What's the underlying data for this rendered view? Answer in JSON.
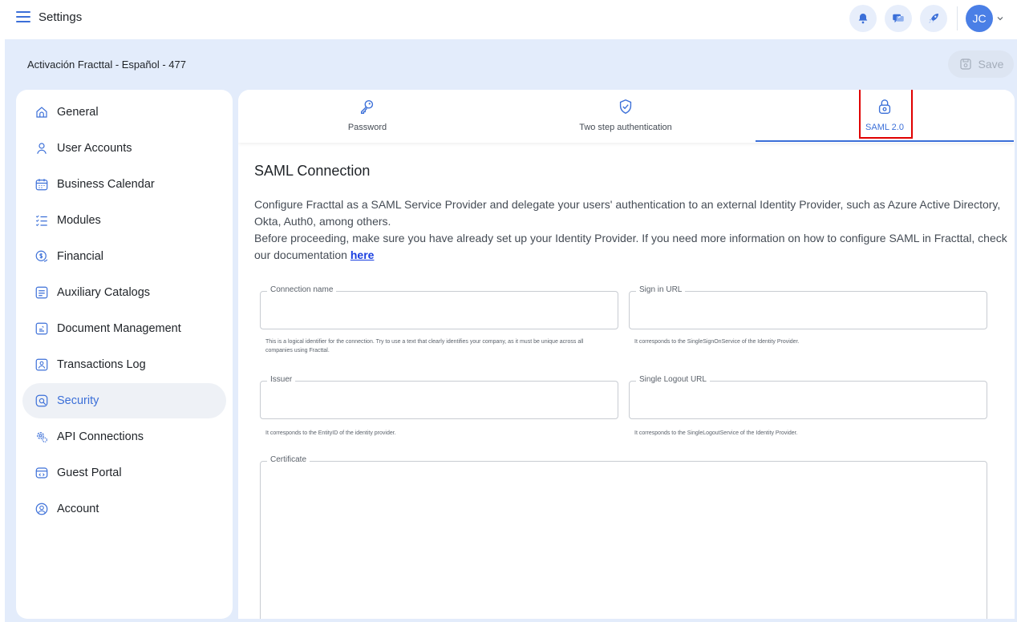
{
  "app": {
    "title": "Settings"
  },
  "header": {
    "breadcrumb": "Activación Fracttal - Español - 477",
    "save_label": "Save",
    "avatar_initials": "JC"
  },
  "sidebar": {
    "items": [
      {
        "label": "General",
        "icon": "home-icon"
      },
      {
        "label": "User Accounts",
        "icon": "user-icon"
      },
      {
        "label": "Business Calendar",
        "icon": "calendar-icon"
      },
      {
        "label": "Modules",
        "icon": "list-icon"
      },
      {
        "label": "Financial",
        "icon": "money-icon"
      },
      {
        "label": "Auxiliary Catalogs",
        "icon": "catalog-icon"
      },
      {
        "label": "Document Management",
        "icon": "document-icon"
      },
      {
        "label": "Transactions Log",
        "icon": "log-icon"
      },
      {
        "label": "Security",
        "icon": "security-icon",
        "active": true
      },
      {
        "label": "API Connections",
        "icon": "api-gear-icon"
      },
      {
        "label": "Guest Portal",
        "icon": "portal-icon"
      },
      {
        "label": "Account",
        "icon": "account-icon"
      }
    ]
  },
  "tabs": [
    {
      "label": "Password",
      "icon": "key-icon"
    },
    {
      "label": "Two step authentication",
      "icon": "shield-check-icon"
    },
    {
      "label": "SAML 2.0",
      "icon": "lock-icon",
      "active": true
    }
  ],
  "saml": {
    "title": "SAML Connection",
    "description_1": "Configure Fracttal as a SAML Service Provider and delegate your users' authentication to an external Identity Provider, such as Azure Active Directory, Okta, Auth0, among others.",
    "description_2": "Before proceeding, make sure you have already set up your Identity Provider. If you need more information on how to configure SAML in Fracttal, check our documentation",
    "doc_link": "here",
    "fields": {
      "connection_name": {
        "label": "Connection name",
        "value": "",
        "hint": "This is a logical identifier for the connection. Try to use a text that clearly identifies your company, as it must be unique across all companies using Fracttal."
      },
      "sign_in_url": {
        "label": "Sign in URL",
        "value": "",
        "hint": "It corresponds to the SingleSignOnService of the Identity Provider."
      },
      "issuer": {
        "label": "Issuer",
        "value": "",
        "hint": "It corresponds to the EntityID of the identity provider."
      },
      "single_logout_url": {
        "label": "Single Logout URL",
        "value": "",
        "hint": "It corresponds to the SingleLogoutService of the Identity Provider."
      },
      "certificate": {
        "label": "Certificate",
        "value": ""
      }
    }
  },
  "colors": {
    "accent": "#3b6fd8",
    "page_bg": "#e3ecfb",
    "highlight": "#e00000",
    "link": "#1a3fe0"
  }
}
